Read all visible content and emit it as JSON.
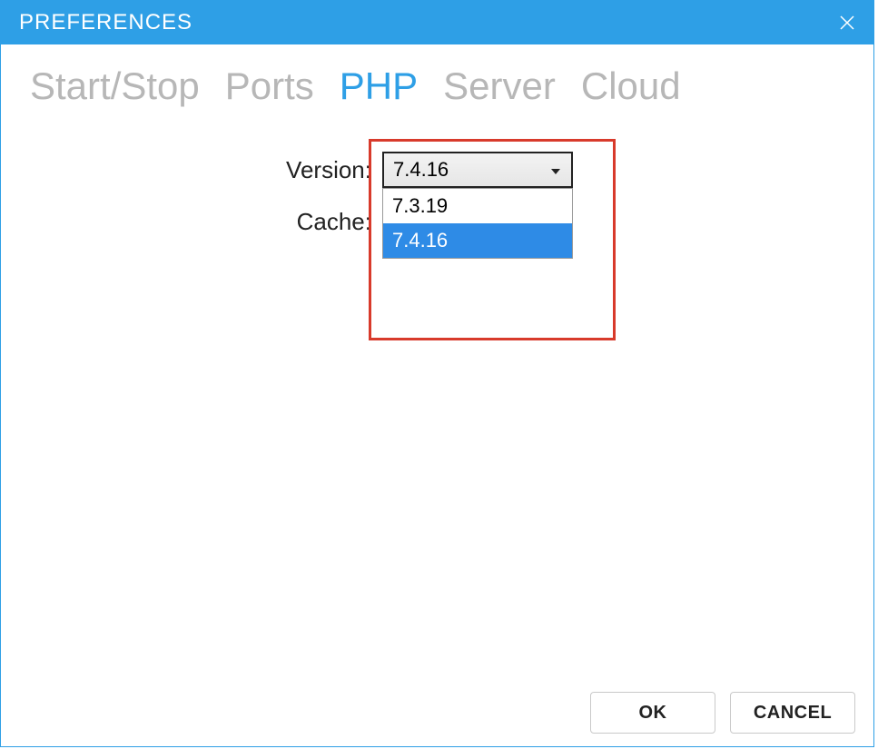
{
  "window": {
    "title": "PREFERENCES"
  },
  "tabs": [
    {
      "label": "Start/Stop",
      "active": false
    },
    {
      "label": "Ports",
      "active": false
    },
    {
      "label": "PHP",
      "active": true
    },
    {
      "label": "Server",
      "active": false
    },
    {
      "label": "Cloud",
      "active": false
    }
  ],
  "form": {
    "version_label": "Version:",
    "cache_label": "Cache:",
    "version_selected": "7.4.16",
    "version_options": [
      "7.3.19",
      "7.4.16"
    ]
  },
  "buttons": {
    "ok": "OK",
    "cancel": "CANCEL"
  },
  "colors": {
    "accent": "#2e9fe6",
    "highlight_border": "#d83a2b",
    "tab_inactive": "#b7b7b7",
    "option_selected_bg": "#2e8be6"
  }
}
